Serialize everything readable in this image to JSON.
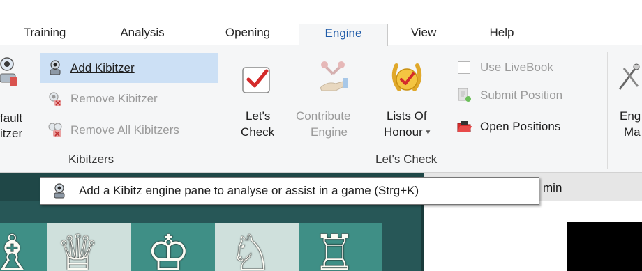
{
  "tabs": [
    {
      "label": "Training"
    },
    {
      "label": "Analysis"
    },
    {
      "label": "Opening"
    },
    {
      "label": "Engine",
      "active": true
    },
    {
      "label": "View"
    },
    {
      "label": "Help"
    }
  ],
  "kibitzers": {
    "default_line1": "fault",
    "default_line2": "itzer",
    "add_label": "Add Kibitzer",
    "remove_label": "Remove Kibitzer",
    "remove_all_label": "Remove All Kibitzers",
    "group_label": "Kibitzers"
  },
  "lets_check": {
    "letscheck_line1": "Let's",
    "letscheck_line2": "Check",
    "contribute_line1": "Contribute",
    "contribute_line2": "Engine",
    "lists_line1": "Lists Of",
    "lists_line2": "Honour",
    "use_livebook": "Use LiveBook",
    "submit_position": "Submit Position",
    "open_positions": "Open Positions",
    "group_label": "Let's Check"
  },
  "partial_right": {
    "line1": "Eng",
    "line2": "Ma"
  },
  "tooltip": {
    "text": "Add a Kibitz engine pane to analyse or assist in a game (Strg+K)"
  },
  "pane": {
    "title_fragment": "min"
  },
  "colors": {
    "accent": "#1e5aa8",
    "ribbon_bg": "#f5f6f7",
    "highlight": "#cce0f5",
    "board_frame": "#275757",
    "board_light": "#cfe0dc",
    "board_dark": "#3f8f86"
  },
  "icons": [
    "kibitzer-icon",
    "remove-kibitzer-icon",
    "remove-all-kibitzers-icon",
    "lets-check-icon",
    "contribute-engine-icon",
    "lists-of-honour-icon",
    "checkbox-icon",
    "submit-position-icon",
    "open-positions-icon",
    "engine-management-icon"
  ]
}
